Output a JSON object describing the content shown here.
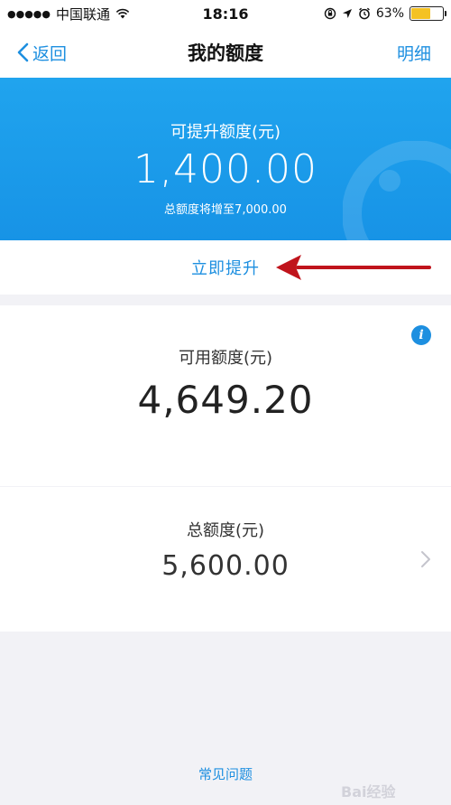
{
  "status_bar": {
    "signal": "●●●●●",
    "carrier": "中国联通",
    "time": "18:16",
    "battery": "63%",
    "battery_level": 0.63,
    "battery_color": "#f4c224"
  },
  "nav": {
    "back_label": "返回",
    "title": "我的额度",
    "detail_label": "明细"
  },
  "promo": {
    "label": "可提升额度(元)",
    "amount": "1,400.00",
    "note": "总额度将增至7,000.00",
    "raise_label": "立即提升",
    "background_color": "#1793e6"
  },
  "available": {
    "label": "可用额度(元)",
    "amount": "4,649.20"
  },
  "total": {
    "label": "总额度(元)",
    "amount": "5,600.00"
  },
  "footer": {
    "faq_label": "常见问题"
  },
  "watermark": {
    "text": "Bai经验"
  },
  "colors": {
    "accent": "#1d8fe0",
    "annotation_arrow": "#c0141c"
  }
}
